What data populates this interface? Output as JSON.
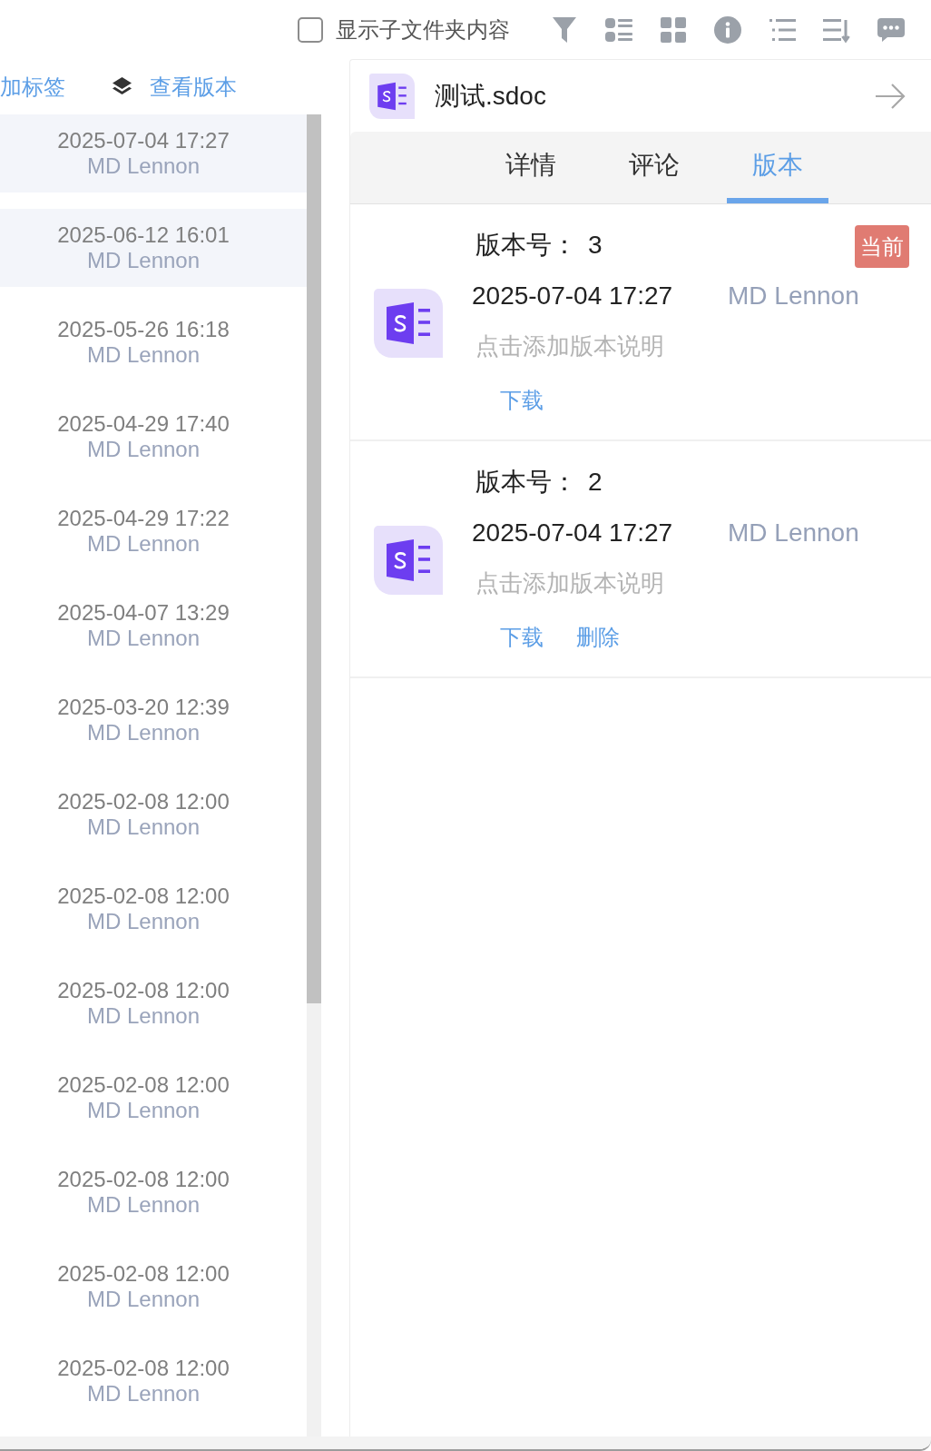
{
  "toolbar": {
    "subfolder_toggle": {
      "label": "显示子文件夹内容",
      "checked": false
    }
  },
  "left_panel": {
    "actions": [
      {
        "kind": "text",
        "label": "加标签"
      },
      {
        "kind": "icon",
        "label": "查看版本"
      }
    ],
    "items": [
      {
        "date": "2025-07-04 17:27",
        "user": "MD Lennon",
        "selected": true
      },
      {
        "date": "2025-06-12 16:01",
        "user": "MD Lennon",
        "selected": true
      },
      {
        "date": "2025-05-26 16:18",
        "user": "MD Lennon",
        "selected": false
      },
      {
        "date": "2025-04-29 17:40",
        "user": "MD Lennon",
        "selected": false
      },
      {
        "date": "2025-04-29 17:22",
        "user": "MD Lennon",
        "selected": false
      },
      {
        "date": "2025-04-07 13:29",
        "user": "MD Lennon",
        "selected": false
      },
      {
        "date": "2025-03-20 12:39",
        "user": "MD Lennon",
        "selected": false
      },
      {
        "date": "2025-02-08 12:00",
        "user": "MD Lennon",
        "selected": false
      },
      {
        "date": "2025-02-08 12:00",
        "user": "MD Lennon",
        "selected": false
      },
      {
        "date": "2025-02-08 12:00",
        "user": "MD Lennon",
        "selected": false
      },
      {
        "date": "2025-02-08 12:00",
        "user": "MD Lennon",
        "selected": false
      },
      {
        "date": "2025-02-08 12:00",
        "user": "MD Lennon",
        "selected": false
      },
      {
        "date": "2025-02-08 12:00",
        "user": "MD Lennon",
        "selected": false
      },
      {
        "date": "2025-02-08 12:00",
        "user": "MD Lennon",
        "selected": false
      }
    ]
  },
  "detail": {
    "file_name": "测试.sdoc",
    "tabs": [
      {
        "label": "详情",
        "selected": false
      },
      {
        "label": "评论",
        "selected": false
      },
      {
        "label": "版本",
        "selected": true
      }
    ],
    "versions": [
      {
        "label": "版本号：",
        "number": "3",
        "badge": "当前",
        "date": "2025-07-04 17:27",
        "user": "MD Lennon",
        "description_hint": "点击添加版本说明",
        "actions": [
          "下载"
        ]
      },
      {
        "label": "版本号：",
        "number": "2",
        "date": "2025-07-04 17:27",
        "user": "MD Lennon",
        "description_hint": "点击添加版本说明",
        "actions": [
          "下载",
          "删除"
        ]
      }
    ]
  }
}
